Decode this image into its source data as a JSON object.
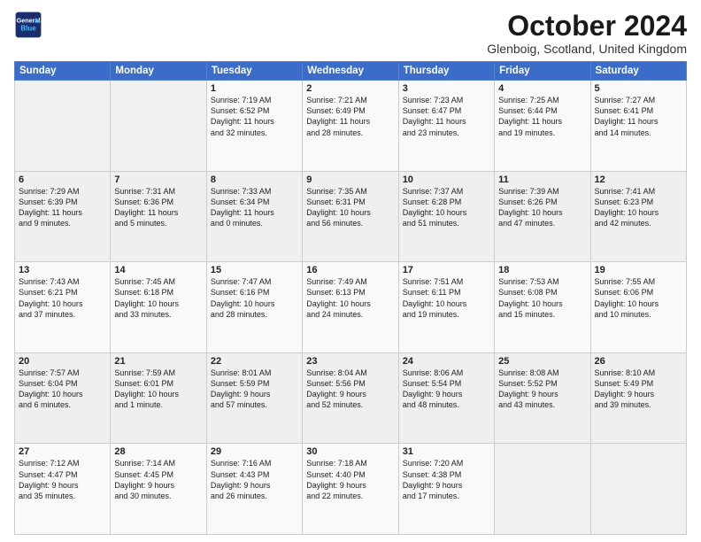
{
  "logo": {
    "line1": "General",
    "line2": "Blue"
  },
  "title": "October 2024",
  "location": "Glenboig, Scotland, United Kingdom",
  "headers": [
    "Sunday",
    "Monday",
    "Tuesday",
    "Wednesday",
    "Thursday",
    "Friday",
    "Saturday"
  ],
  "weeks": [
    [
      {
        "day": "",
        "info": ""
      },
      {
        "day": "",
        "info": ""
      },
      {
        "day": "1",
        "info": "Sunrise: 7:19 AM\nSunset: 6:52 PM\nDaylight: 11 hours\nand 32 minutes."
      },
      {
        "day": "2",
        "info": "Sunrise: 7:21 AM\nSunset: 6:49 PM\nDaylight: 11 hours\nand 28 minutes."
      },
      {
        "day": "3",
        "info": "Sunrise: 7:23 AM\nSunset: 6:47 PM\nDaylight: 11 hours\nand 23 minutes."
      },
      {
        "day": "4",
        "info": "Sunrise: 7:25 AM\nSunset: 6:44 PM\nDaylight: 11 hours\nand 19 minutes."
      },
      {
        "day": "5",
        "info": "Sunrise: 7:27 AM\nSunset: 6:41 PM\nDaylight: 11 hours\nand 14 minutes."
      }
    ],
    [
      {
        "day": "6",
        "info": "Sunrise: 7:29 AM\nSunset: 6:39 PM\nDaylight: 11 hours\nand 9 minutes."
      },
      {
        "day": "7",
        "info": "Sunrise: 7:31 AM\nSunset: 6:36 PM\nDaylight: 11 hours\nand 5 minutes."
      },
      {
        "day": "8",
        "info": "Sunrise: 7:33 AM\nSunset: 6:34 PM\nDaylight: 11 hours\nand 0 minutes."
      },
      {
        "day": "9",
        "info": "Sunrise: 7:35 AM\nSunset: 6:31 PM\nDaylight: 10 hours\nand 56 minutes."
      },
      {
        "day": "10",
        "info": "Sunrise: 7:37 AM\nSunset: 6:28 PM\nDaylight: 10 hours\nand 51 minutes."
      },
      {
        "day": "11",
        "info": "Sunrise: 7:39 AM\nSunset: 6:26 PM\nDaylight: 10 hours\nand 47 minutes."
      },
      {
        "day": "12",
        "info": "Sunrise: 7:41 AM\nSunset: 6:23 PM\nDaylight: 10 hours\nand 42 minutes."
      }
    ],
    [
      {
        "day": "13",
        "info": "Sunrise: 7:43 AM\nSunset: 6:21 PM\nDaylight: 10 hours\nand 37 minutes."
      },
      {
        "day": "14",
        "info": "Sunrise: 7:45 AM\nSunset: 6:18 PM\nDaylight: 10 hours\nand 33 minutes."
      },
      {
        "day": "15",
        "info": "Sunrise: 7:47 AM\nSunset: 6:16 PM\nDaylight: 10 hours\nand 28 minutes."
      },
      {
        "day": "16",
        "info": "Sunrise: 7:49 AM\nSunset: 6:13 PM\nDaylight: 10 hours\nand 24 minutes."
      },
      {
        "day": "17",
        "info": "Sunrise: 7:51 AM\nSunset: 6:11 PM\nDaylight: 10 hours\nand 19 minutes."
      },
      {
        "day": "18",
        "info": "Sunrise: 7:53 AM\nSunset: 6:08 PM\nDaylight: 10 hours\nand 15 minutes."
      },
      {
        "day": "19",
        "info": "Sunrise: 7:55 AM\nSunset: 6:06 PM\nDaylight: 10 hours\nand 10 minutes."
      }
    ],
    [
      {
        "day": "20",
        "info": "Sunrise: 7:57 AM\nSunset: 6:04 PM\nDaylight: 10 hours\nand 6 minutes."
      },
      {
        "day": "21",
        "info": "Sunrise: 7:59 AM\nSunset: 6:01 PM\nDaylight: 10 hours\nand 1 minute."
      },
      {
        "day": "22",
        "info": "Sunrise: 8:01 AM\nSunset: 5:59 PM\nDaylight: 9 hours\nand 57 minutes."
      },
      {
        "day": "23",
        "info": "Sunrise: 8:04 AM\nSunset: 5:56 PM\nDaylight: 9 hours\nand 52 minutes."
      },
      {
        "day": "24",
        "info": "Sunrise: 8:06 AM\nSunset: 5:54 PM\nDaylight: 9 hours\nand 48 minutes."
      },
      {
        "day": "25",
        "info": "Sunrise: 8:08 AM\nSunset: 5:52 PM\nDaylight: 9 hours\nand 43 minutes."
      },
      {
        "day": "26",
        "info": "Sunrise: 8:10 AM\nSunset: 5:49 PM\nDaylight: 9 hours\nand 39 minutes."
      }
    ],
    [
      {
        "day": "27",
        "info": "Sunrise: 7:12 AM\nSunset: 4:47 PM\nDaylight: 9 hours\nand 35 minutes."
      },
      {
        "day": "28",
        "info": "Sunrise: 7:14 AM\nSunset: 4:45 PM\nDaylight: 9 hours\nand 30 minutes."
      },
      {
        "day": "29",
        "info": "Sunrise: 7:16 AM\nSunset: 4:43 PM\nDaylight: 9 hours\nand 26 minutes."
      },
      {
        "day": "30",
        "info": "Sunrise: 7:18 AM\nSunset: 4:40 PM\nDaylight: 9 hours\nand 22 minutes."
      },
      {
        "day": "31",
        "info": "Sunrise: 7:20 AM\nSunset: 4:38 PM\nDaylight: 9 hours\nand 17 minutes."
      },
      {
        "day": "",
        "info": ""
      },
      {
        "day": "",
        "info": ""
      }
    ]
  ]
}
